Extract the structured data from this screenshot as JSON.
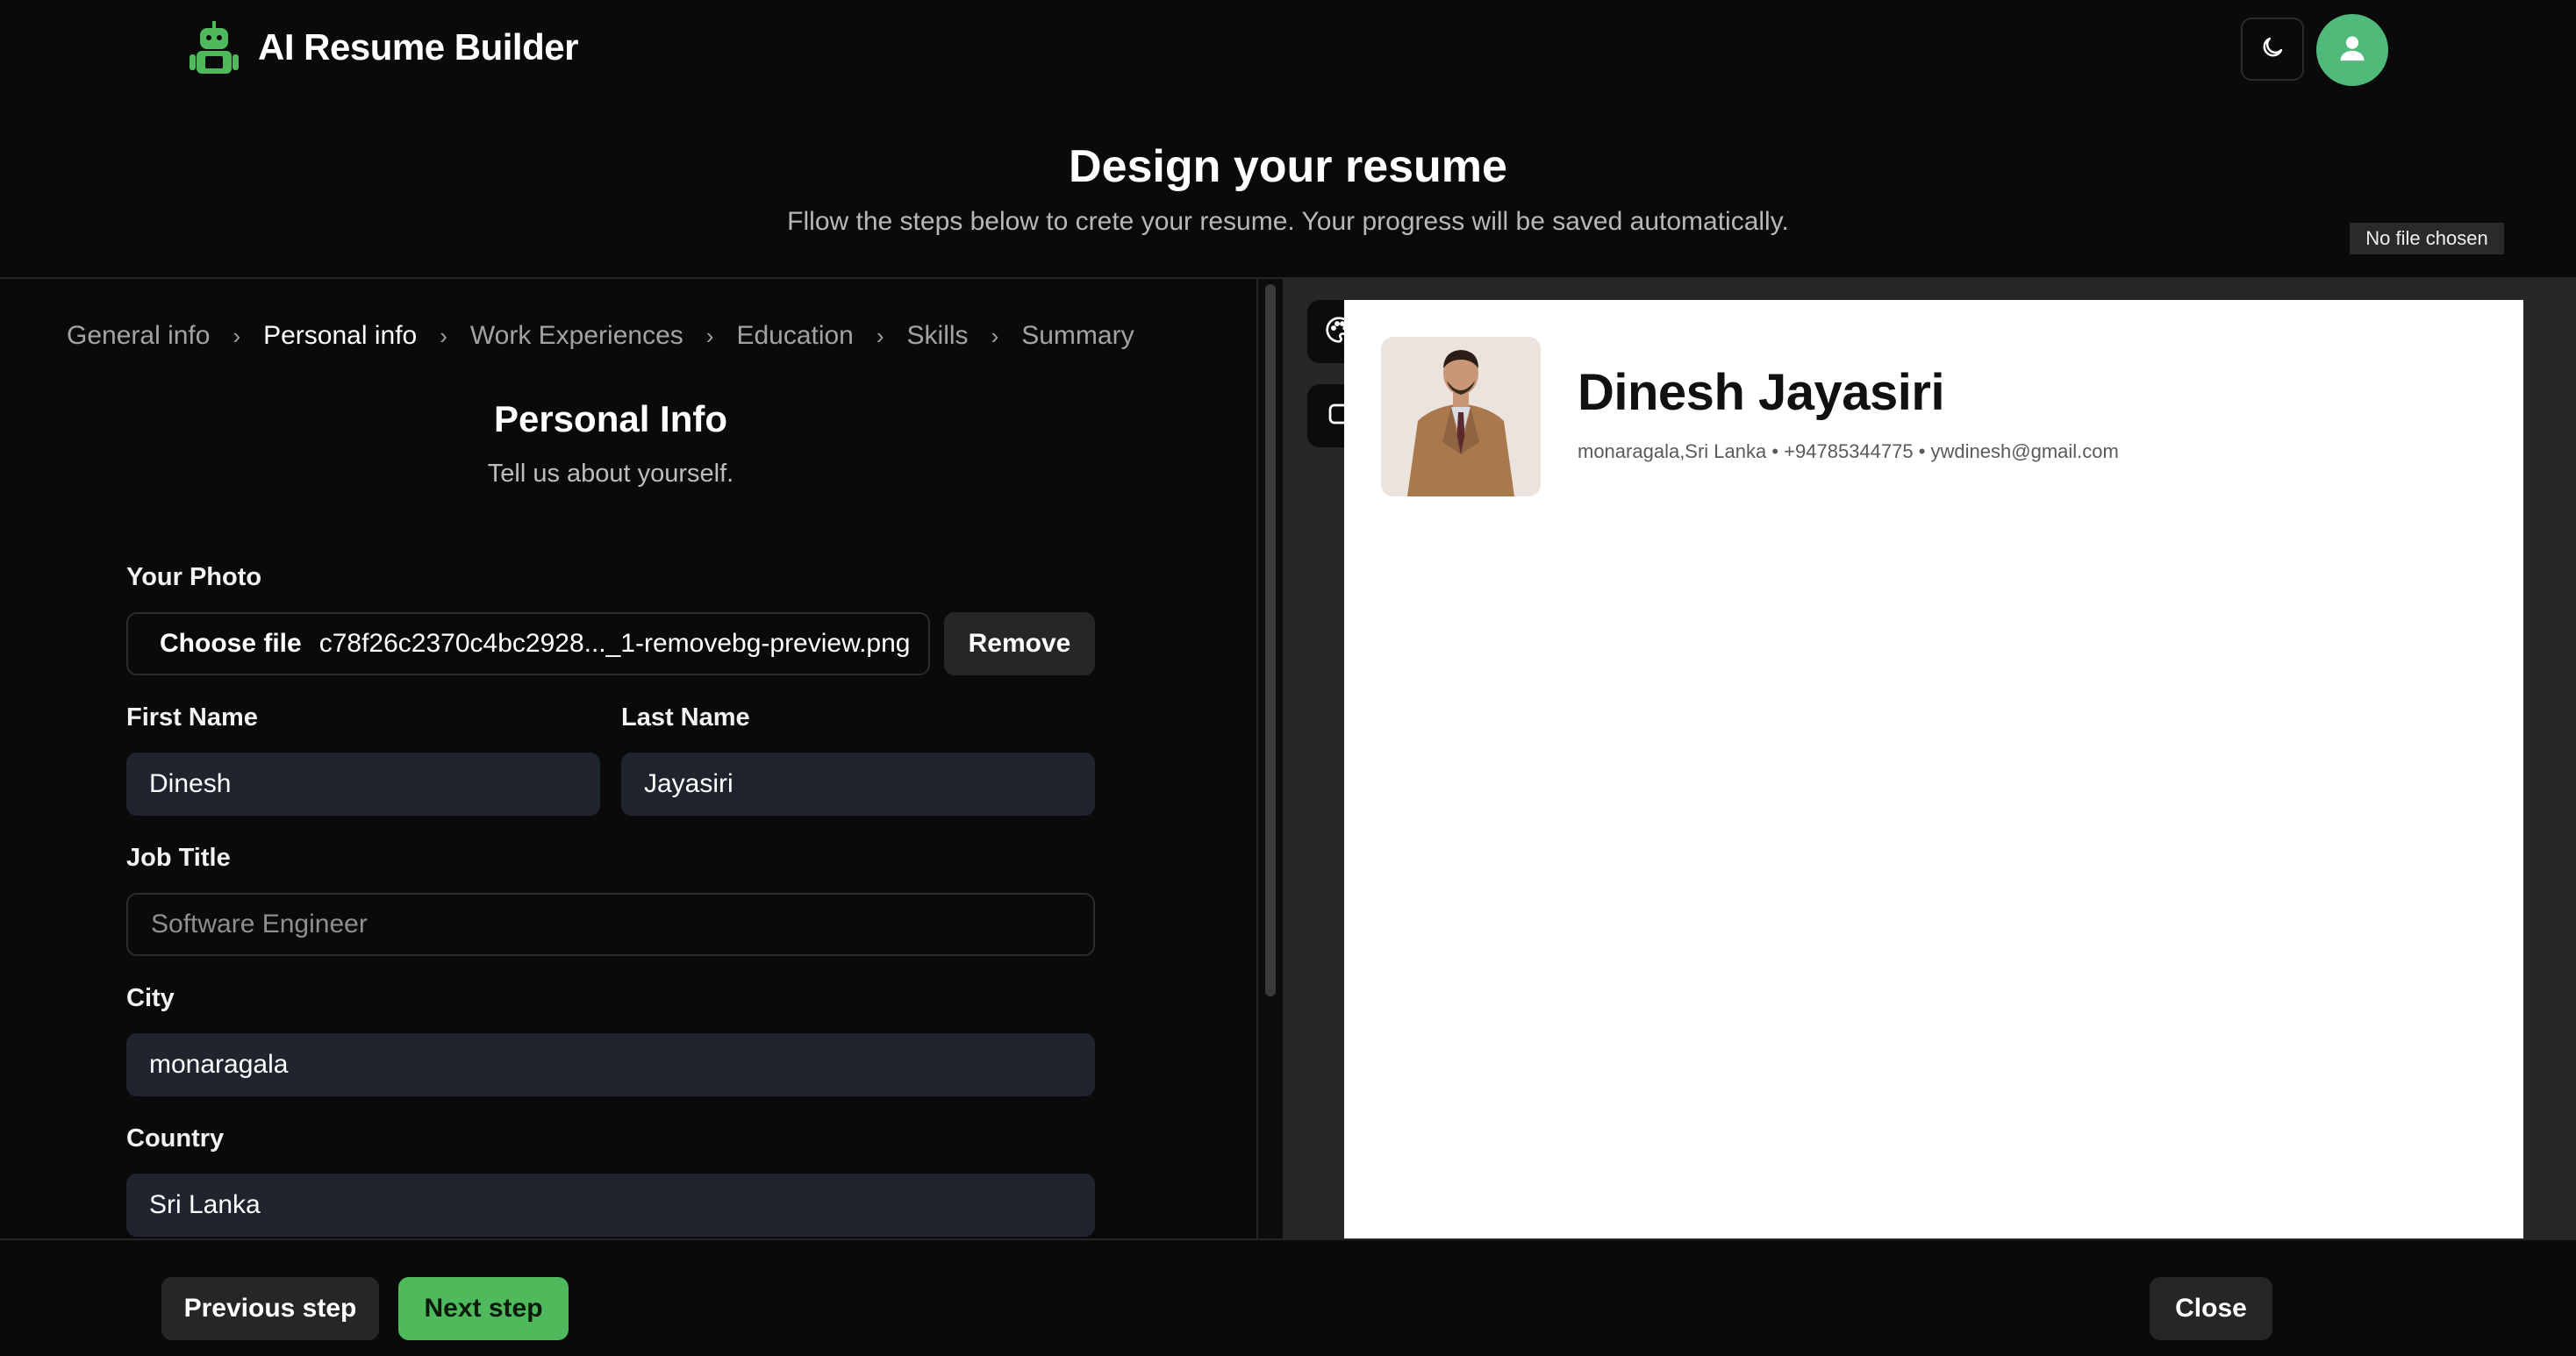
{
  "header": {
    "brand": "AI Resume Builder"
  },
  "page": {
    "title": "Design your resume",
    "subtitle": "Fllow the steps below to crete your resume. Your progress will be saved automatically.",
    "no_file_tooltip": "No file chosen"
  },
  "steps": [
    {
      "label": "General info",
      "active": false
    },
    {
      "label": "Personal info",
      "active": true
    },
    {
      "label": "Work Experiences",
      "active": false
    },
    {
      "label": "Education",
      "active": false
    },
    {
      "label": "Skills",
      "active": false
    },
    {
      "label": "Summary",
      "active": false
    }
  ],
  "form": {
    "title": "Personal Info",
    "subtitle": "Tell us about yourself.",
    "photo": {
      "label": "Your Photo",
      "choose_label": "Choose file",
      "file_name": "c78f26c2370c4bc2928..._1-removebg-preview.png",
      "remove_label": "Remove"
    },
    "first_name": {
      "label": "First Name",
      "value": "Dinesh"
    },
    "last_name": {
      "label": "Last Name",
      "value": "Jayasiri"
    },
    "job_title": {
      "label": "Job Title",
      "placeholder": "Software Engineer"
    },
    "city": {
      "label": "City",
      "value": "monaragala"
    },
    "country": {
      "label": "Country",
      "value": "Sri Lanka"
    }
  },
  "preview": {
    "name": "Dinesh Jayasiri",
    "contact": "monaragala,Sri Lanka • +94785344775 • ywdinesh@gmail.com"
  },
  "footer": {
    "previous_label": "Previous step",
    "next_label": "Next step",
    "close_label": "Close"
  },
  "icons": {
    "logo": "robot-logo-icon",
    "theme": "moon-icon",
    "user": "user-icon",
    "color_picker": "palette-icon",
    "border_style": "square-icon"
  },
  "colors": {
    "accent_green": "#4fba5c",
    "avatar_green": "#4fba7a",
    "input_fill": "#1f242e"
  }
}
